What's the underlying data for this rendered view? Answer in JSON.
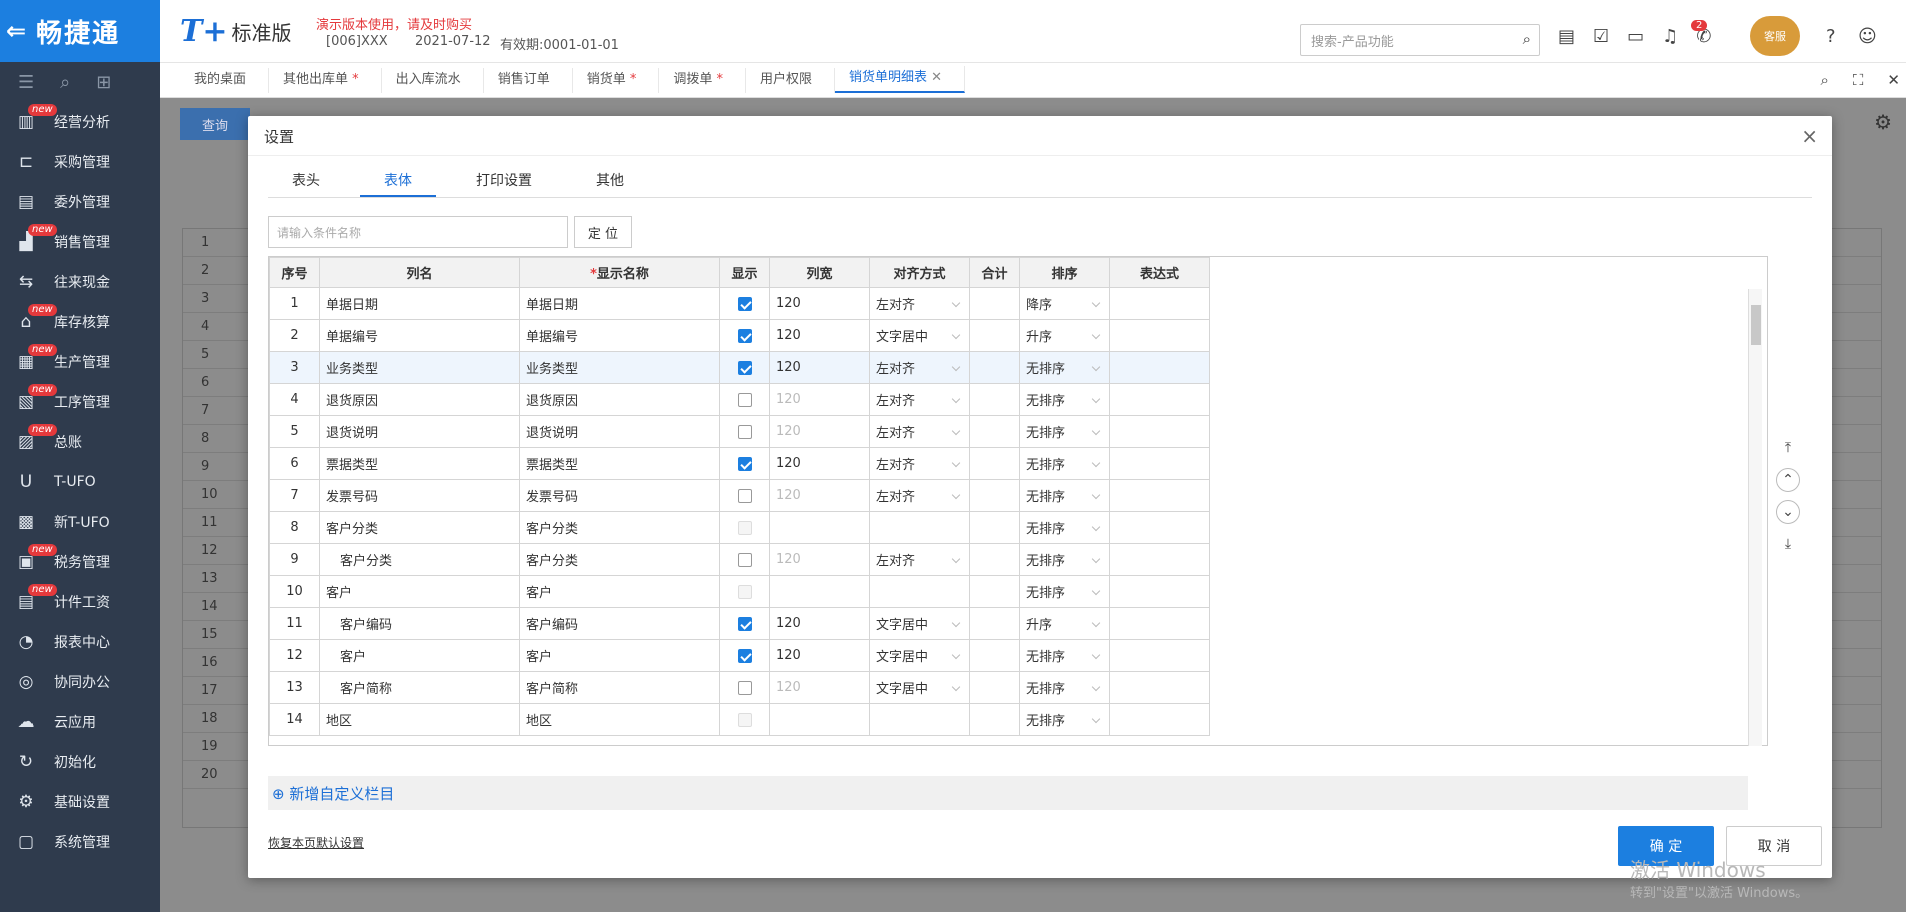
{
  "app": {
    "logo": "畅捷通",
    "brand_t": "T+",
    "brand_std": "标准版",
    "demo_notice": "演示版本使用，请及时购买",
    "account": "[006]XXX",
    "date": "2021-07-12",
    "valid": "有效期:0001-01-01",
    "search_placeholder": "搜索-产品功能",
    "notif_count": "2",
    "avatar_text": "客服"
  },
  "sidebar": [
    {
      "label": "经营分析",
      "icon": "chart-icon",
      "new": true
    },
    {
      "label": "采购管理",
      "icon": "cart-icon",
      "new": false
    },
    {
      "label": "委外管理",
      "icon": "doc-icon",
      "new": false
    },
    {
      "label": "销售管理",
      "icon": "sales-icon",
      "new": true
    },
    {
      "label": "往来现金",
      "icon": "cash-icon",
      "new": false
    },
    {
      "label": "库存核算",
      "icon": "warehouse-icon",
      "new": true
    },
    {
      "label": "生产管理",
      "icon": "production-icon",
      "new": true
    },
    {
      "label": "工序管理",
      "icon": "process-icon",
      "new": true
    },
    {
      "label": "总账",
      "icon": "ledger-icon",
      "new": true
    },
    {
      "label": "T-UFO",
      "icon": "ufo-icon",
      "new": false
    },
    {
      "label": "新T-UFO",
      "icon": "newufo-icon",
      "new": false
    },
    {
      "label": "税务管理",
      "icon": "tax-icon",
      "new": true
    },
    {
      "label": "计件工资",
      "icon": "wage-icon",
      "new": true
    },
    {
      "label": "报表中心",
      "icon": "report-icon",
      "new": false
    },
    {
      "label": "协同办公",
      "icon": "collab-icon",
      "new": false
    },
    {
      "label": "云应用",
      "icon": "cloud-icon",
      "new": false
    },
    {
      "label": "初始化",
      "icon": "init-icon",
      "new": false
    },
    {
      "label": "基础设置",
      "icon": "settings-icon",
      "new": false
    },
    {
      "label": "系统管理",
      "icon": "system-icon",
      "new": false
    }
  ],
  "tabs": [
    {
      "label": "我的桌面",
      "mark": ""
    },
    {
      "label": "其他出库单",
      "mark": " *"
    },
    {
      "label": "出入库流水",
      "mark": ""
    },
    {
      "label": "销售订单",
      "mark": ""
    },
    {
      "label": "销货单",
      "mark": " *"
    },
    {
      "label": "调拨单",
      "mark": " *"
    },
    {
      "label": "用户权限",
      "mark": ""
    },
    {
      "label": "销货单明细表",
      "mark": ""
    }
  ],
  "background": {
    "query_button": "查询",
    "rows": [
      "1",
      "2",
      "3",
      "4",
      "5",
      "6",
      "7",
      "8",
      "9",
      "10",
      "11",
      "12",
      "13",
      "14",
      "15",
      "16",
      "17",
      "18",
      "19",
      "20"
    ]
  },
  "dialog": {
    "title": "设置",
    "tabs": [
      "表头",
      "表体",
      "打印设置",
      "其他"
    ],
    "condition_placeholder": "请输入条件名称",
    "locate_button": "定 位",
    "columns": [
      "序号",
      "列名",
      "显示名称",
      "显示",
      "列宽",
      "对齐方式",
      "合计",
      "排序",
      "表达式"
    ],
    "rows": [
      {
        "no": "1",
        "name": "单据日期",
        "display": "单据日期",
        "show": "on",
        "width": "120",
        "align": "左对齐",
        "sort": "降序",
        "indent": false
      },
      {
        "no": "2",
        "name": "单据编号",
        "display": "单据编号",
        "show": "on",
        "width": "120",
        "align": "文字居中",
        "sort": "升序",
        "indent": false
      },
      {
        "no": "3",
        "name": "业务类型",
        "display": "业务类型",
        "show": "on",
        "width": "120",
        "align": "左对齐",
        "sort": "无排序",
        "indent": false
      },
      {
        "no": "4",
        "name": "退货原因",
        "display": "退货原因",
        "show": "off",
        "width": "120",
        "align": "左对齐",
        "sort": "无排序",
        "indent": false
      },
      {
        "no": "5",
        "name": "退货说明",
        "display": "退货说明",
        "show": "off",
        "width": "120",
        "align": "左对齐",
        "sort": "无排序",
        "indent": false
      },
      {
        "no": "6",
        "name": "票据类型",
        "display": "票据类型",
        "show": "on",
        "width": "120",
        "align": "左对齐",
        "sort": "无排序",
        "indent": false
      },
      {
        "no": "7",
        "name": "发票号码",
        "display": "发票号码",
        "show": "off",
        "width": "120",
        "align": "左对齐",
        "sort": "无排序",
        "indent": false
      },
      {
        "no": "8",
        "name": "客户分类",
        "display": "客户分类",
        "show": "dis",
        "width": "",
        "align": "",
        "sort": "无排序",
        "indent": false
      },
      {
        "no": "9",
        "name": "客户分类",
        "display": "客户分类",
        "show": "off",
        "width": "120",
        "align": "左对齐",
        "sort": "无排序",
        "indent": true
      },
      {
        "no": "10",
        "name": "客户",
        "display": "客户",
        "show": "dis",
        "width": "",
        "align": "",
        "sort": "无排序",
        "indent": false
      },
      {
        "no": "11",
        "name": "客户编码",
        "display": "客户编码",
        "show": "on",
        "width": "120",
        "align": "文字居中",
        "sort": "升序",
        "indent": true
      },
      {
        "no": "12",
        "name": "客户",
        "display": "客户",
        "show": "on",
        "width": "120",
        "align": "文字居中",
        "sort": "无排序",
        "indent": true
      },
      {
        "no": "13",
        "name": "客户简称",
        "display": "客户简称",
        "show": "off",
        "width": "120",
        "align": "文字居中",
        "sort": "无排序",
        "indent": true
      },
      {
        "no": "14",
        "name": "地区",
        "display": "地区",
        "show": "dis",
        "width": "",
        "align": "",
        "sort": "无排序",
        "indent": false
      }
    ],
    "add_custom": "新增自定义栏目",
    "restore_default": "恢复本页默认设置",
    "ok_button": "确 定",
    "cancel_button": "取 消"
  },
  "watermark": {
    "line1": "激活 Windows",
    "line2": "转到\"设置\"以激活 Windows。"
  }
}
